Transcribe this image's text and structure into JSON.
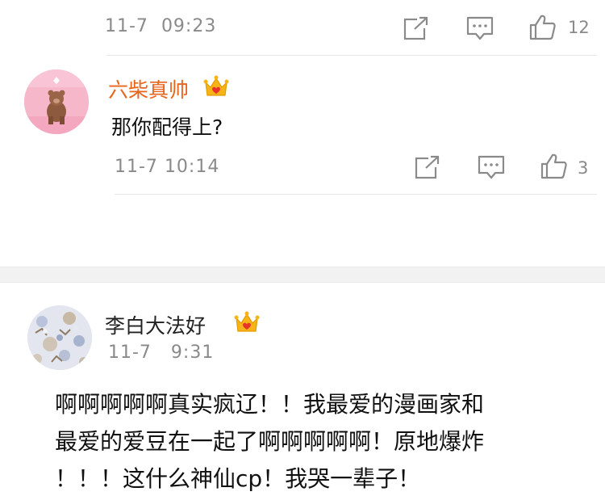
{
  "top_comment": {
    "date": "11-7",
    "time": "09:23",
    "like_count": "12",
    "icons": [
      "share-icon",
      "comment-icon",
      "like-icon"
    ]
  },
  "reply": {
    "username": "六柴真帅",
    "badge_icon": "vip-crown-icon",
    "text": "那你配得上?",
    "date": "11-7",
    "time": "10:14",
    "like_count": "3",
    "icons": [
      "share-icon",
      "comment-icon",
      "like-icon"
    ],
    "colors": {
      "username": "#e8651e",
      "avatar_bg": "#f7b6cc"
    }
  },
  "post": {
    "username": "李白大法好",
    "badge_icon": "vip-crown-icon",
    "date": "11-7",
    "time": "9:31",
    "lines": [
      "啊啊啊啊啊真实疯辽！！我最爱的漫画家和",
      "最爱的爱豆在一起了啊啊啊啊啊！原地爆炸",
      "！！！这什么神仙cp！我哭一辈子！"
    ]
  }
}
